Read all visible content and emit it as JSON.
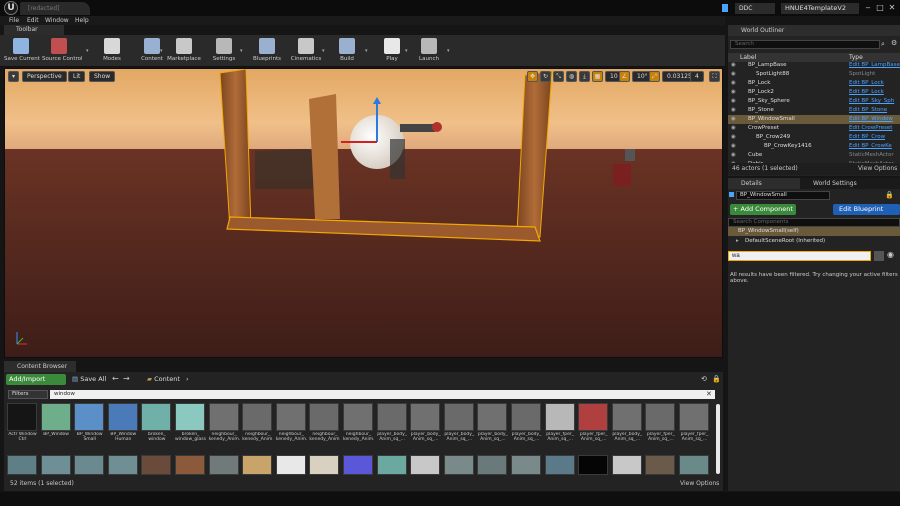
{
  "window": {
    "logo": "U",
    "tab_title": "[redacted]",
    "ddc_label": "DDC",
    "project_name": "HNUE4TemplateV2"
  },
  "menu": [
    "File",
    "Edit",
    "Window",
    "Help"
  ],
  "toolbar": {
    "tab_label": "Toolbar",
    "tools": [
      {
        "id": "save-current",
        "label": "Save Current",
        "icon": "save-icon",
        "color": "#8fb4e0"
      },
      {
        "id": "source-control",
        "label": "Source Control",
        "icon": "source-control-icon",
        "color": "#c05050"
      },
      {
        "id": "modes",
        "label": "Modes",
        "icon": "modes-icon",
        "color": "#d8d8d8"
      },
      {
        "id": "content",
        "label": "Content",
        "icon": "content-icon",
        "color": "#9ab0d0"
      },
      {
        "id": "marketplace",
        "label": "Marketplace",
        "icon": "marketplace-icon",
        "color": "#c8c8c8"
      },
      {
        "id": "settings",
        "label": "Settings",
        "icon": "settings-icon",
        "color": "#b8b8b8"
      },
      {
        "id": "blueprints",
        "label": "Blueprints",
        "icon": "blueprints-icon",
        "color": "#9ab0d0"
      },
      {
        "id": "cinematics",
        "label": "Cinematics",
        "icon": "cinematics-icon",
        "color": "#c8c8c8"
      },
      {
        "id": "build",
        "label": "Build",
        "icon": "build-icon",
        "color": "#9ab0d0"
      },
      {
        "id": "play",
        "label": "Play",
        "icon": "play-icon",
        "color": "#e8e8e8"
      },
      {
        "id": "launch",
        "label": "Launch",
        "icon": "launch-icon",
        "color": "#b8b8b8"
      }
    ]
  },
  "viewport": {
    "perspective": "Perspective",
    "lit": "Lit",
    "show": "Show",
    "angle": "10°",
    "scale": "0.03125",
    "speed": "4"
  },
  "world_outliner": {
    "tab_label": "World Outliner",
    "search_placeholder": "Search",
    "col_label": "Label",
    "col_type": "Type",
    "rows": [
      {
        "label": "BP_LampBase",
        "type": "Edit BP_LampBase",
        "indent": 1,
        "link": true,
        "selected": false
      },
      {
        "label": "SpotLight88",
        "type": "SpotLight",
        "indent": 2,
        "link": false,
        "selected": false
      },
      {
        "label": "BP_Lock",
        "type": "Edit BP_Lock",
        "indent": 1,
        "link": true,
        "selected": false
      },
      {
        "label": "BP_Lock2",
        "type": "Edit BP_Lock",
        "indent": 1,
        "link": true,
        "selected": false
      },
      {
        "label": "BP_Sky_Sphere",
        "type": "Edit BP_Sky_Sph",
        "indent": 1,
        "link": true,
        "selected": false
      },
      {
        "label": "BP_Stone",
        "type": "Edit BP_Stone",
        "indent": 1,
        "link": true,
        "selected": false
      },
      {
        "label": "BP_WindowSmall",
        "type": "Edit BP_Window",
        "indent": 1,
        "link": true,
        "selected": true
      },
      {
        "label": "CrowPreset",
        "type": "Edit CrowPreset",
        "indent": 1,
        "link": true,
        "selected": false
      },
      {
        "label": "BP_Crow249",
        "type": "Edit BP_Crow",
        "indent": 2,
        "link": true,
        "selected": false
      },
      {
        "label": "BP_CrowKey1416",
        "type": "Edit BP_CrowKe",
        "indent": 3,
        "link": true,
        "selected": false
      },
      {
        "label": "Cube",
        "type": "StaticMeshActor",
        "indent": 1,
        "link": false,
        "selected": false
      },
      {
        "label": "Debis",
        "type": "StaticMeshActor",
        "indent": 1,
        "link": false,
        "selected": false
      }
    ],
    "actor_count": "46 actors (1 selected)",
    "view_options": "View Options"
  },
  "details": {
    "tab_label": "Details",
    "world_settings_label": "World Settings",
    "name_value": "BP_WindowSmall",
    "add_component": "+ Add Component",
    "edit_blueprint": "Edit Blueprint",
    "search_components": "Search Components",
    "self_row": "BP_WindowSmall(self)",
    "root_row": "DefaultSceneRoot (Inherited)",
    "filter_value": "wa",
    "filter_message": "All results have been filtered. Try changing your active filters above."
  },
  "content_browser": {
    "tab_label": "Content Browser",
    "add_import": "Add/Import",
    "save_all": "Save All",
    "breadcrumb": "Content",
    "filters": "Filters",
    "search_value": "window",
    "row1": [
      {
        "name": "Actr Window Ctrl",
        "color": "#151515"
      },
      {
        "name": "BP_Window",
        "color": "#6fae8a"
      },
      {
        "name": "BP_Window Small",
        "color": "#5a8fc8"
      },
      {
        "name": "BP_Window Human",
        "color": "#4a7ab8"
      },
      {
        "name": "broken_ window",
        "color": "#6fb0a8"
      },
      {
        "name": "broken_ window_glass",
        "color": "#8ac8c0"
      },
      {
        "name": "neighbour_ kenedy_Anim...",
        "color": "#707070"
      },
      {
        "name": "neighbour_ kenedy_Anim...",
        "color": "#6a6a6a"
      },
      {
        "name": "neighbour_ kenedy_Anim...",
        "color": "#707070"
      },
      {
        "name": "neighbour_ kenedy_Anim...",
        "color": "#6a6a6a"
      },
      {
        "name": "neighbour_ kenedy_Anim...",
        "color": "#707070"
      },
      {
        "name": "player_body_ Anim_sq_...",
        "color": "#6a6a6a"
      },
      {
        "name": "player_body_ Anim_sq_...",
        "color": "#707070"
      },
      {
        "name": "player_body_ Anim_sq_...",
        "color": "#6a6a6a"
      },
      {
        "name": "player_body_ Anim_sq_...",
        "color": "#707070"
      },
      {
        "name": "player_body_ Anim_sq_...",
        "color": "#6a6a6a"
      },
      {
        "name": "player_fper_ Anim_sq_...",
        "color": "#b8b8b8"
      },
      {
        "name": "player_fper_ Anim_sq_...",
        "color": "#b04040"
      },
      {
        "name": "player_body_ Anim_sq_...",
        "color": "#707070"
      },
      {
        "name": "player_fper_ Anim_sq_...",
        "color": "#6a6a6a"
      },
      {
        "name": "player_fper_ Anim_sq_...",
        "color": "#707070"
      }
    ],
    "row2_colors": [
      "#5f7f86",
      "#6d8f95",
      "#6a8a90",
      "#6f8f95",
      "#6a4a3a",
      "#8a5a3a",
      "#707a7a",
      "#c9a46a",
      "#e8e8e8",
      "#d8d0c0",
      "#5a58d8",
      "#6aa8a0",
      "#c8c8c8",
      "#7a8a8a",
      "#6a7a7a",
      "#7a8a8a",
      "#5a7a8a",
      "#050505",
      "#c8c8c8",
      "#6a5a4a",
      "#6a8a8a"
    ],
    "item_count": "52 items (1 selected)",
    "view_options": "View Options"
  }
}
